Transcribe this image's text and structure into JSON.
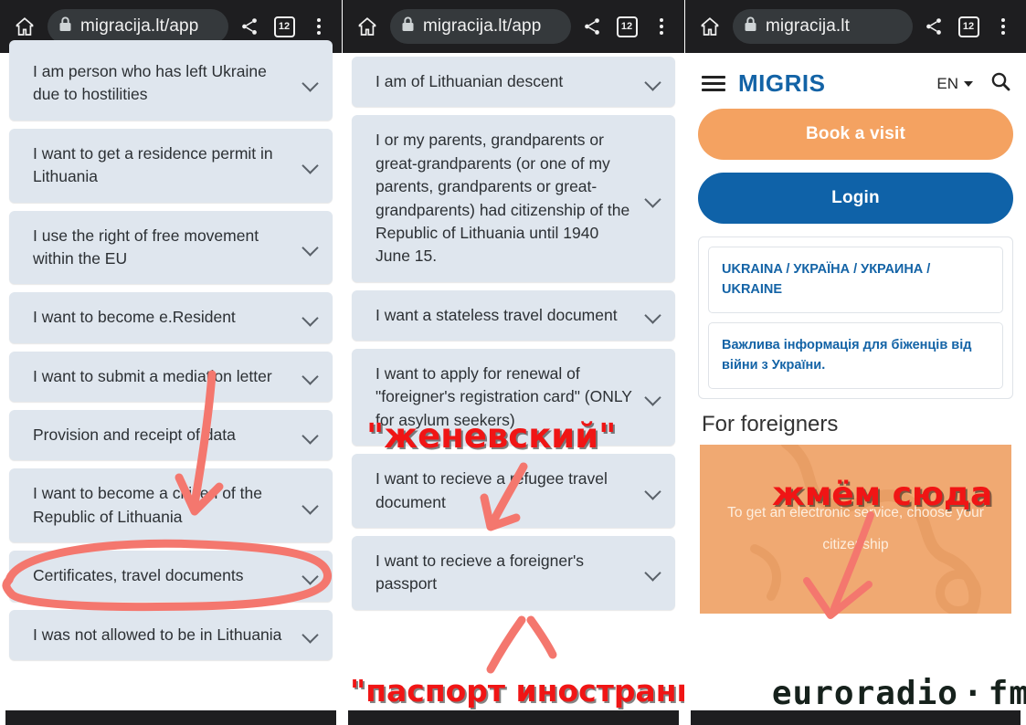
{
  "browser": {
    "home_icon": "home-icon",
    "lock_icon": "lock-icon",
    "share_icon": "share-icon",
    "menu_icon": "kebab-menu-icon",
    "tab_count": "12",
    "url_left": "migracija.lt/app",
    "url_mid": "migracija.lt/app",
    "url_right": "migracija.lt"
  },
  "panel_left": {
    "cards": [
      {
        "label": "I am person who has left Ukraine due to hostilities"
      },
      {
        "label": "I want to get a residence permit in Lithuania"
      },
      {
        "label": "I use the right of free movement within the EU"
      },
      {
        "label": "I want to become e.Resident"
      },
      {
        "label": "I want to submit a mediation letter"
      },
      {
        "label": "Provision and receipt of data"
      },
      {
        "label": "I want to become a citizen of the Republic of Lithuania"
      },
      {
        "label": "Certificates, travel documents"
      },
      {
        "label": "I was not allowed to be in Lithuania"
      }
    ],
    "highlighted_card": "Certificates, travel documents"
  },
  "panel_mid": {
    "cards": [
      {
        "label": "I am of Lithuanian descent"
      },
      {
        "label": "I or my parents, grandparents or great-grandparents (or one of my parents, grandparents or great-grandparents) had citizenship of the Republic of Lithuania until 1940 June 15."
      },
      {
        "label": "I want a stateless travel document"
      },
      {
        "label": "I want to apply for renewal of \"foreigner's registration card\" (ONLY for asylum seekers)"
      },
      {
        "label": "I want to recieve a refugee travel document"
      },
      {
        "label": "I want to recieve a foreigner's passport"
      }
    ],
    "annotations": {
      "zhenevskiy": "\"женевский\"",
      "pasport": "\"паспорт иностранца\""
    }
  },
  "panel_right": {
    "brand": "MIGRIS",
    "menu_icon": "hamburger-menu-icon",
    "language": "EN",
    "search_icon": "search-icon",
    "book_visit": "Book a visit",
    "login": "Login",
    "info_items": [
      "UKRAINA / УКРАЇНА / УКРАИНА / UKRAINE",
      "Важлива інформація для біженців від війни з України."
    ],
    "section_title": "For foreigners",
    "hero_text": "To get an electronic service, choose your citizenship",
    "annotations": {
      "zhmem_syuda": "жмём сюда"
    }
  },
  "watermark": {
    "text_euro": "euro",
    "text_radio": "radio",
    "text_dot": "·",
    "text_fm": "fm",
    "accent_color": "#2fbf9c"
  },
  "colors": {
    "card_bg": "#dfe6ee",
    "chrome_bg": "#1e1e20",
    "brand_blue": "#1363a6",
    "orange": "#f4a261",
    "login_blue": "#0f62a8",
    "annotation_red": "#f01515"
  }
}
